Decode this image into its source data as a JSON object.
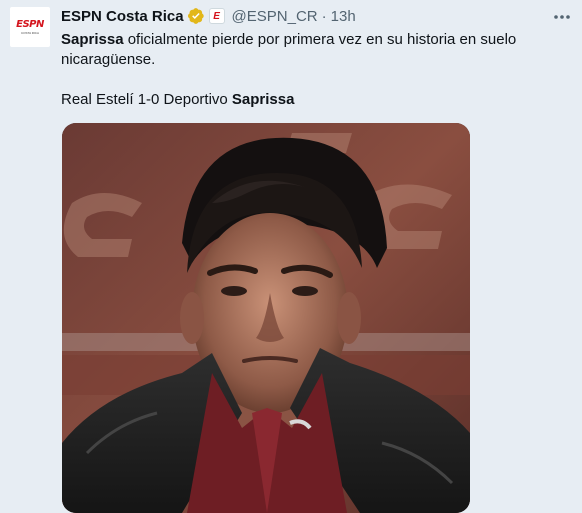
{
  "author": {
    "display_name": "ESPN Costa Rica",
    "handle": "@ESPN_CR",
    "separator": "·",
    "time": "13h",
    "avatar_logo": "ESPN",
    "avatar_sub": "COSTA RICA",
    "affiliate_badge": "E"
  },
  "tweet": {
    "line1_bold": "Saprissa",
    "line1_rest": " oficialmente pierde por primera vez en su historia en suelo nicaragüense.",
    "line2_prefix": "Real Estelí 1-0 Deportivo ",
    "line2_bold": "Saprissa"
  },
  "icons": {
    "verified": "verified-badge-icon",
    "more": "more-options-icon",
    "affiliate": "espn-affiliate-badge-icon"
  },
  "colors": {
    "background": "#e7edf3",
    "text": "#0f1419",
    "secondary": "#536471",
    "verified_gold": "#e2b719",
    "espn_red": "#d4141d"
  }
}
